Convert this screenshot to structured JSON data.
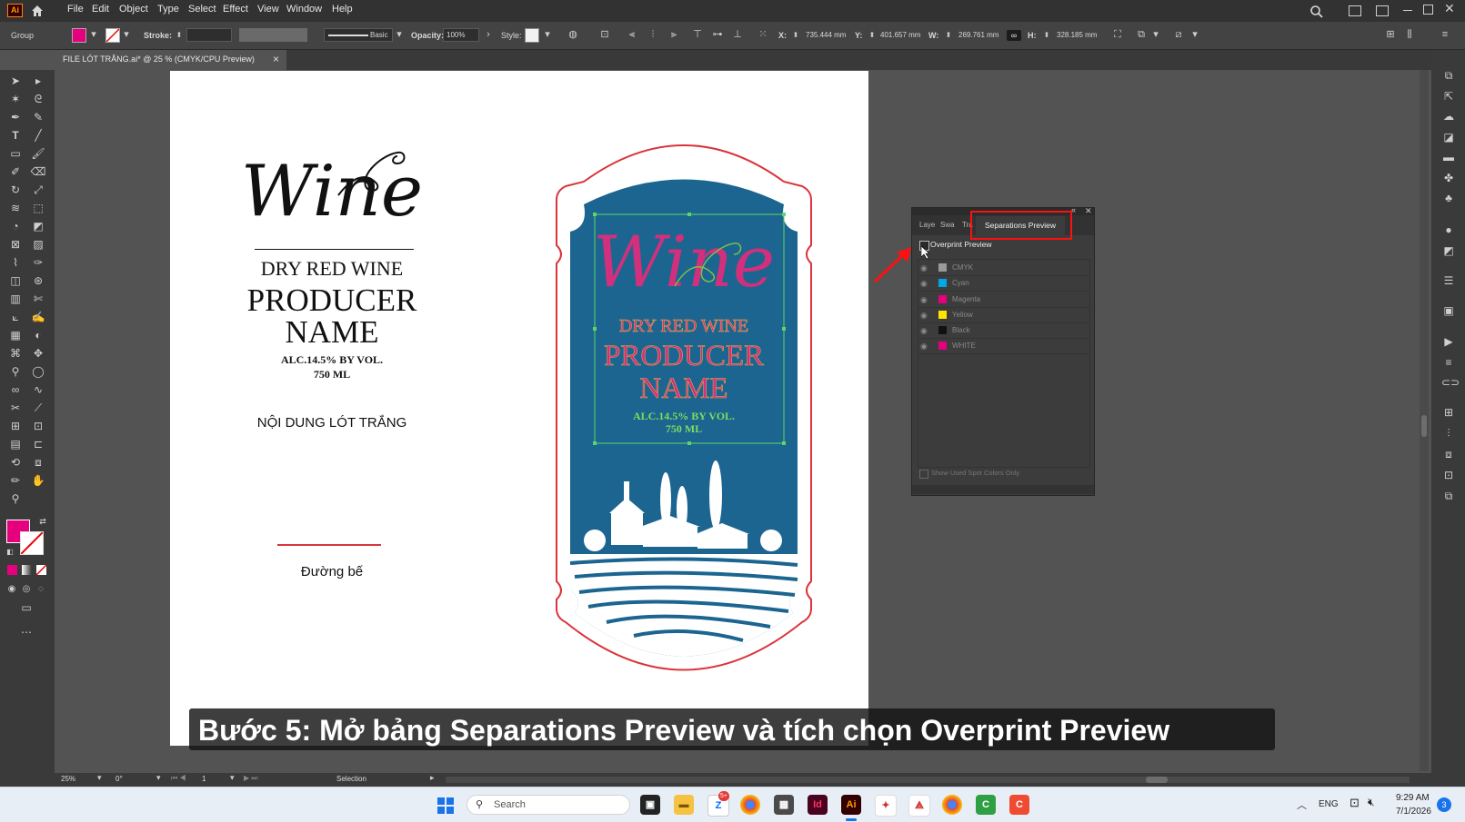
{
  "app": {
    "logo": "Ai",
    "home_icon": "home-icon"
  },
  "menu": [
    "File",
    "Edit",
    "Object",
    "Type",
    "Select",
    "Effect",
    "View",
    "Window",
    "Help"
  ],
  "control": {
    "selection_type": "Group",
    "stroke_label": "Stroke:",
    "brush": "Basic",
    "opacity_label": "Opacity:",
    "opacity_value": "100%",
    "style_label": "Style:",
    "x_label": "X:",
    "x_value": "735.444 mm",
    "y_label": "Y:",
    "y_value": "401.657 mm",
    "w_label": "W:",
    "w_value": "269.761 mm",
    "h_label": "H:",
    "h_value": "328.185 mm"
  },
  "document_tab": {
    "title": "FILE LÓT TRẮNG.ai* @ 25 % (CMYK/CPU Preview)",
    "close": "×"
  },
  "artboard": {
    "left_label": {
      "script": "Wine",
      "line1": "DRY RED WINE",
      "line2": "PRODUCER",
      "line3": "NAME",
      "alc": "ALC.14.5% BY VOL.",
      "ml": "750 ML",
      "note": "NỘI DUNG LÓT TRẮNG",
      "base_label": "Đường bế"
    },
    "right_label": {
      "script": "Wine",
      "line1": "DRY RED WINE",
      "line2": "PRODUCER",
      "line3": "NAME",
      "alc": "ALC.14.5% BY VOL.",
      "ml": "750 ML"
    }
  },
  "panel": {
    "tabs": [
      "Laye",
      "Swa",
      "Tra",
      "Separations Preview"
    ],
    "active_tab": "Separations Preview",
    "overprint_label": "Overprint Preview",
    "rows": [
      {
        "name": "CMYK",
        "color": "#9a9a9a"
      },
      {
        "name": "Cyan",
        "color": "#00a6e6"
      },
      {
        "name": "Magenta",
        "color": "#e6007e"
      },
      {
        "name": "Yellow",
        "color": "#ffe600"
      },
      {
        "name": "Black",
        "color": "#111111"
      },
      {
        "name": "WHITE",
        "color": "#e6007e"
      }
    ],
    "footer": "Show Used Spot Colors Only"
  },
  "status": {
    "zoom": "25%",
    "rotation": "0°",
    "artboard": "1",
    "tool": "Selection"
  },
  "caption": "Bước 5: Mở bảng Separations Preview và tích chọn Overprint Preview",
  "taskbar": {
    "search_placeholder": "Search",
    "lang": "ENG",
    "time": "9:29 AM",
    "date": "7/1/2026",
    "notification_count": "3"
  },
  "colors": {
    "fill": "#e6007e",
    "label_blue": "#1b6590",
    "diecut_red": "#d9353b",
    "highlight_red": "#ff1010",
    "selection_green": "#5cd66a"
  }
}
